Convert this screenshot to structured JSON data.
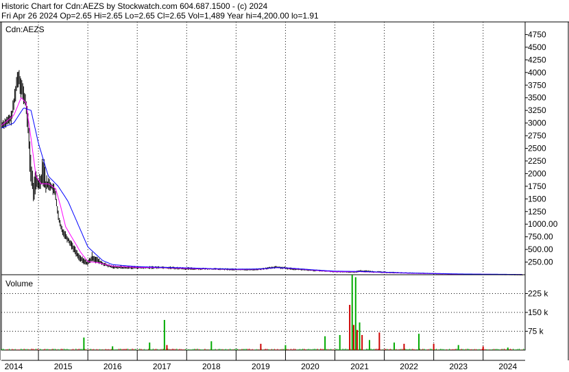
{
  "header": {
    "line1": "Historic Chart for Cdn:AEZS by Stockwatch.com 604.687.1500 - (c) 2024",
    "line2": "Fri Apr 26 2024   Op=2.65   Hi=2.65   Lo=2.65   Cl=2.65   Vol=1,489   Year hi=4,200.00   lo=1.91"
  },
  "colors": {
    "price_bar": "#000000",
    "ma_short": "#ff00ff",
    "ma_long": "#0000ff",
    "volume_up": "#00aa00",
    "volume_down": "#cc0000",
    "grid": "#000000",
    "frame": "#000000"
  },
  "chart_data": [
    {
      "type": "line",
      "panel": "price",
      "title": "Cdn:AEZS",
      "xlabel": "",
      "ylabel": "",
      "x_range": [
        2013.75,
        2024.35
      ],
      "ylim": [
        0,
        5000
      ],
      "y_ticks": [
        250,
        500,
        750,
        1000,
        1250,
        1500,
        1750,
        2000,
        2250,
        2500,
        2750,
        3000,
        3250,
        3500,
        3750,
        4000,
        4250,
        4500,
        4750
      ],
      "y_tick_labels": [
        "250.00",
        "500.00",
        "750.00",
        "1000.00",
        "1250",
        "1500",
        "1750",
        "2000",
        "2250",
        "2500",
        "2750",
        "3000",
        "3250",
        "3500",
        "3750",
        "4000",
        "4250",
        "4500",
        "4750"
      ],
      "x_ticks": [
        2014,
        2015,
        2016,
        2017,
        2018,
        2019,
        2020,
        2021,
        2022,
        2023,
        2024
      ],
      "x_tick_labels": [
        "2014",
        "2015",
        "2016",
        "2017",
        "2018",
        "2019",
        "2020",
        "2021",
        "2022",
        "2023",
        "2024"
      ],
      "grid": true,
      "price": {
        "x": [
          2013.75,
          2013.85,
          2013.95,
          2014.0,
          2014.05,
          2014.1,
          2014.15,
          2014.2,
          2014.25,
          2014.3,
          2014.35,
          2014.4,
          2014.45,
          2014.5,
          2014.55,
          2014.6,
          2014.65,
          2014.7,
          2014.75,
          2014.8,
          2014.85,
          2014.9,
          2014.95,
          2015.0,
          2015.1,
          2015.2,
          2015.3,
          2015.4,
          2015.5,
          2015.6,
          2015.7,
          2015.8,
          2015.9,
          2016.0,
          2016.3,
          2016.6,
          2017.0,
          2017.5,
          2018.0,
          2018.5,
          2018.8,
          2019.0,
          2019.3,
          2019.6,
          2020.0,
          2020.5,
          2020.9,
          2021.0,
          2021.5,
          2022.0,
          2022.5,
          2023.0,
          2023.5,
          2024.0,
          2024.3
        ],
        "close": [
          2950,
          3000,
          3100,
          3350,
          3700,
          3950,
          3750,
          3600,
          3400,
          2900,
          2100,
          1700,
          1800,
          1750,
          1850,
          2000,
          1750,
          1800,
          1750,
          1700,
          1600,
          1150,
          950,
          850,
          700,
          550,
          380,
          260,
          220,
          320,
          280,
          220,
          180,
          150,
          140,
          140,
          145,
          120,
          115,
          100,
          100,
          110,
          150,
          120,
          90,
          60,
          50,
          70,
          45,
          30,
          20,
          10,
          6,
          4,
          2.65
        ],
        "high": [
          3100,
          3150,
          3250,
          3550,
          4000,
          4200,
          4000,
          3750,
          3600,
          3100,
          2400,
          1900,
          2100,
          2000,
          2100,
          2700,
          2000,
          1950,
          1900,
          1850,
          1700,
          1300,
          1050,
          950,
          800,
          650,
          450,
          350,
          300,
          480,
          350,
          270,
          220,
          190,
          180,
          170,
          175,
          150,
          135,
          125,
          120,
          130,
          180,
          145,
          110,
          80,
          70,
          100,
          65,
          45,
          35,
          20,
          12,
          8,
          2.65
        ],
        "low": [
          2850,
          2900,
          2950,
          3200,
          3500,
          3700,
          3450,
          3300,
          3100,
          2500,
          1500,
          1400,
          1650,
          1650,
          1700,
          1750,
          1600,
          1650,
          1650,
          1550,
          1400,
          1000,
          850,
          750,
          600,
          450,
          300,
          200,
          180,
          250,
          200,
          170,
          140,
          120,
          110,
          110,
          115,
          90,
          95,
          80,
          80,
          90,
          120,
          95,
          70,
          45,
          35,
          50,
          30,
          20,
          12,
          5,
          3,
          2,
          2.65
        ]
      },
      "series": [
        {
          "x": [
            2013.75,
            2014.0,
            2014.15,
            2014.25,
            2014.35,
            2014.45,
            2014.55,
            2014.7,
            2014.85,
            2014.95,
            2015.05,
            2015.2,
            2015.35,
            2015.5,
            2015.7,
            2016.0,
            2016.5,
            2017.0,
            2017.5,
            2018.0,
            2018.5,
            2019.0,
            2019.3,
            2019.6,
            2020.0,
            2020.5,
            2021.0,
            2021.5,
            2022.0,
            2023.0,
            2024.3
          ],
          "values": [
            2950,
            3150,
            3500,
            3400,
            2700,
            1950,
            1800,
            1800,
            1700,
            1350,
            950,
            700,
            450,
            260,
            240,
            170,
            145,
            140,
            125,
            115,
            105,
            110,
            140,
            125,
            95,
            60,
            60,
            45,
            30,
            12,
            3
          ]
        },
        {
          "x": [
            2013.75,
            2014.0,
            2014.2,
            2014.35,
            2014.5,
            2014.7,
            2014.9,
            2015.1,
            2015.3,
            2015.5,
            2015.8,
            2016.0,
            2016.5,
            2017.0,
            2017.5,
            2018.0,
            2018.5,
            2019.0,
            2019.3,
            2019.6,
            2020.0,
            2020.5,
            2021.0,
            2021.5,
            2022.0,
            2023.0,
            2024.3
          ],
          "values": [
            2900,
            3000,
            3300,
            3250,
            2600,
            1950,
            1750,
            1450,
            1000,
            550,
            280,
            200,
            160,
            145,
            135,
            120,
            110,
            115,
            140,
            130,
            100,
            70,
            65,
            50,
            35,
            15,
            5
          ]
        }
      ]
    },
    {
      "type": "bar",
      "panel": "volume",
      "title": "Volume",
      "xlabel": "",
      "ylabel": "",
      "x_range": [
        2013.75,
        2024.35
      ],
      "ylim": [
        0,
        300000
      ],
      "y_ticks": [
        75000,
        150000,
        225000
      ],
      "y_tick_labels": [
        "75 k",
        "150 k",
        "225 k"
      ],
      "grid": true,
      "spikes": {
        "x": [
          2015.42,
          2016.0,
          2016.75,
          2017.05,
          2017.1,
          2018.0,
          2019.0,
          2019.5,
          2020.3,
          2020.6,
          2020.8,
          2020.85,
          2020.88,
          2020.92,
          2020.95,
          2021.0,
          2021.05,
          2021.2,
          2021.4,
          2021.7,
          2021.9,
          2022.2,
          2022.5,
          2023.0,
          2023.5,
          2024.0
        ],
        "values": [
          50000,
          15000,
          30000,
          120000,
          20000,
          35000,
          25000,
          20000,
          55000,
          60000,
          180000,
          300000,
          100000,
          290000,
          80000,
          110000,
          60000,
          40000,
          70000,
          30000,
          25000,
          65000,
          25000,
          20000,
          15000,
          10000
        ],
        "direction": [
          "up",
          "up",
          "up",
          "up",
          "down",
          "up",
          "down",
          "up",
          "up",
          "up",
          "down",
          "up",
          "down",
          "up",
          "down",
          "up",
          "down",
          "up",
          "down",
          "up",
          "down",
          "up",
          "down",
          "up",
          "down",
          "up"
        ]
      }
    }
  ]
}
